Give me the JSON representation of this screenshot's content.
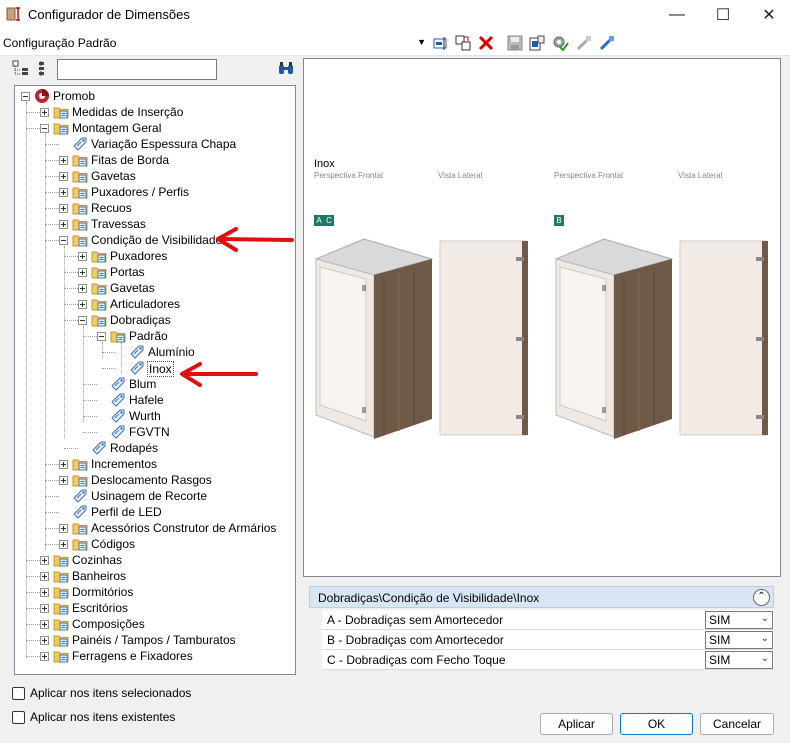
{
  "window": {
    "title": "Configurador de Dimensões",
    "minimize_icon": "minimize-icon",
    "maximize_icon": "maximize-icon",
    "close_icon": "close-icon"
  },
  "toolbar": {
    "configuration_value": "Configuração Padrão",
    "icons": [
      "edit-config-icon",
      "copy-config-icon",
      "delete-icon",
      "save-icon",
      "export-icon",
      "apply-settings-icon",
      "connect-icon",
      "link-icon"
    ]
  },
  "tree_toolbar": {
    "expand_all_icon": "expand-tree-icon",
    "collapse_all_icon": "collapse-tree-icon",
    "search_value": "",
    "search_icon": "binoculars-icon"
  },
  "tree": {
    "items": [
      {
        "label": "Promob"
      },
      {
        "label": "Medidas de Inserção"
      },
      {
        "label": "Montagem Geral"
      },
      {
        "label": "Variação Espessura Chapa"
      },
      {
        "label": "Fitas de Borda"
      },
      {
        "label": "Gavetas"
      },
      {
        "label": "Puxadores / Perfis"
      },
      {
        "label": "Recuos"
      },
      {
        "label": "Travessas"
      },
      {
        "label": "Condição de Visibilidade"
      },
      {
        "label": "Puxadores"
      },
      {
        "label": "Portas"
      },
      {
        "label": "Gavetas"
      },
      {
        "label": "Articuladores"
      },
      {
        "label": "Dobradiças"
      },
      {
        "label": "Padrão"
      },
      {
        "label": "Alumínio"
      },
      {
        "label": "Inox"
      },
      {
        "label": "Blum"
      },
      {
        "label": "Hafele"
      },
      {
        "label": "Wurth"
      },
      {
        "label": "FGVTN"
      },
      {
        "label": "Rodapés"
      },
      {
        "label": "Incrementos"
      },
      {
        "label": "Deslocamento Rasgos"
      },
      {
        "label": "Usinagem de Recorte"
      },
      {
        "label": "Perfil de LED"
      },
      {
        "label": "Acessórios Construtor de Armários"
      },
      {
        "label": "Códigos"
      },
      {
        "label": "Cozinhas"
      },
      {
        "label": "Banheiros"
      },
      {
        "label": "Dormitórios"
      },
      {
        "label": "Escritórios"
      },
      {
        "label": "Composições"
      },
      {
        "label": "Painéis / Tampos / Tamburatos"
      },
      {
        "label": "Ferragens e Fixadores"
      }
    ]
  },
  "preview": {
    "title": "Inox",
    "labels": [
      "Perspectiva Frontal",
      "Vista Lateral",
      "Perspectiva Frontal",
      "Vista Lateral"
    ],
    "badges": [
      "A",
      "C",
      "B"
    ],
    "colors": {
      "wood": "#6f5a47",
      "panel": "#f2ebe5",
      "badge": "#1e7a62"
    }
  },
  "properties": {
    "header": "Dobradiças\\Condição de Visibilidade\\Inox",
    "collapse_icon": "chevron-up-double-icon",
    "rows": [
      {
        "label": "A - Dobradiças sem Amortecedor",
        "value": "SIM"
      },
      {
        "label": "B - Dobradiças com Amortecedor",
        "value": "SIM"
      },
      {
        "label": "C - Dobradiças com Fecho Toque",
        "value": "SIM"
      }
    ]
  },
  "options": {
    "apply_selected": "Aplicar nos itens selecionados",
    "apply_existing": "Aplicar nos itens existentes"
  },
  "buttons": {
    "apply": "Aplicar",
    "ok": "OK",
    "cancel": "Cancelar"
  }
}
